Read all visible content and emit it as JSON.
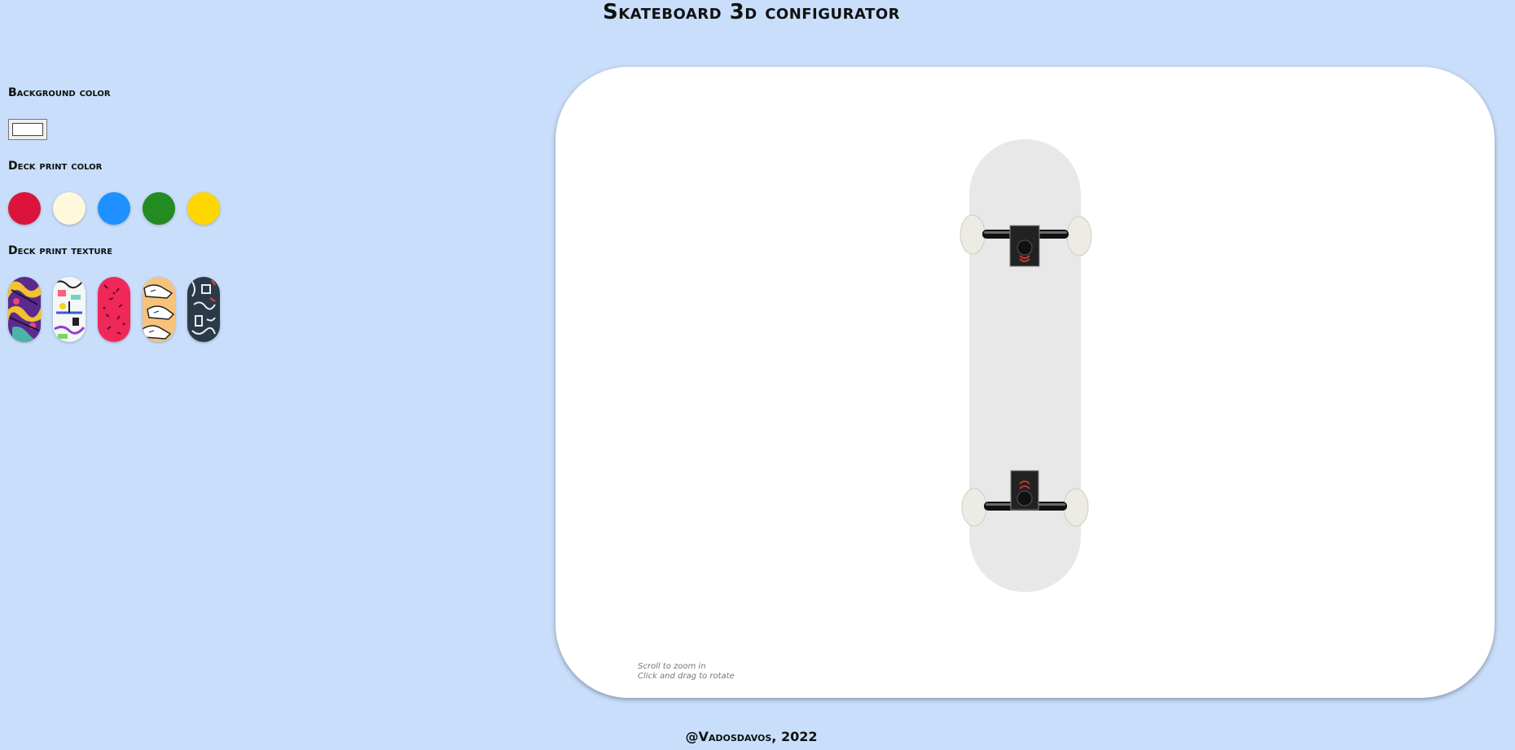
{
  "header": {
    "title": "Skateboard 3d configurator"
  },
  "sidebar": {
    "background_label": "Background color",
    "background_value": "#ffffff",
    "deck_color_label": "Deck print color",
    "deck_colors": [
      {
        "name": "crimson",
        "hex": "#dc143c"
      },
      {
        "name": "cream",
        "hex": "#fff8dc"
      },
      {
        "name": "blue",
        "hex": "#1e90ff"
      },
      {
        "name": "green",
        "hex": "#228b22"
      },
      {
        "name": "yellow",
        "hex": "#ffd700"
      }
    ],
    "texture_label": "Deck print texture",
    "textures": [
      {
        "name": "purple-yellow-abstract"
      },
      {
        "name": "colorful-doodles"
      },
      {
        "name": "red-pattern"
      },
      {
        "name": "orange-sneakers"
      },
      {
        "name": "dark-graffiti"
      }
    ]
  },
  "viewer": {
    "deck_color": "#e8e8e8",
    "hint_zoom": "Scroll to zoom in",
    "hint_rotate": "Click and drag to rotate"
  },
  "footer": {
    "credit": "@Vadosdavos, 2022"
  }
}
